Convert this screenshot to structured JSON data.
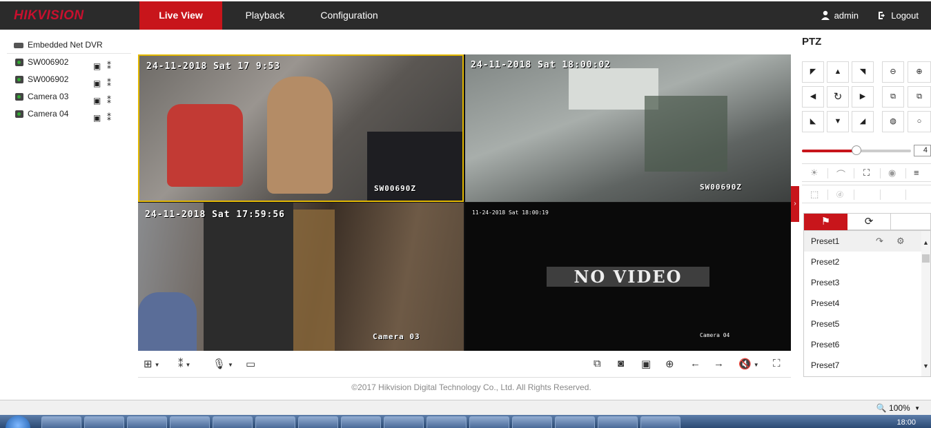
{
  "brand": "HIKVISION",
  "nav": {
    "tabs": [
      "Live View",
      "Playback",
      "Configuration"
    ],
    "active": "Live View"
  },
  "user": {
    "name": "admin",
    "logout": "Logout"
  },
  "tree": {
    "root": "Embedded Net DVR",
    "cameras": [
      "SW006902",
      "SW006902",
      "Camera 03",
      "Camera 04"
    ]
  },
  "video": {
    "cells": [
      {
        "timestamp": "24-11-2018 Sat 17  9:53",
        "name": "SW00690Z"
      },
      {
        "timestamp": "24-11-2018 Sat 18:00:02",
        "name": "SW00690Z"
      },
      {
        "timestamp": "24-11-2018 Sat 17:59:56",
        "name": "Camera 03"
      },
      {
        "timestamp": "11-24-2018 Sat 18:00:19",
        "name": "Camera 04",
        "status": "NO VIDEO"
      }
    ]
  },
  "footer": "©2017 Hikvision Digital Technology Co., Ltd. All Rights Reserved.",
  "ptz": {
    "title": "PTZ",
    "speed": "4",
    "speed_level": 0.5,
    "presets": [
      "Preset1",
      "Preset2",
      "Preset3",
      "Preset4",
      "Preset5",
      "Preset6",
      "Preset7"
    ]
  },
  "status": {
    "zoom": "100%"
  },
  "taskbar": {
    "clock": "18:00"
  },
  "colors": {
    "accent": "#c8151b",
    "topbar": "#2b2b2b",
    "selected_border": "#e3b800"
  }
}
